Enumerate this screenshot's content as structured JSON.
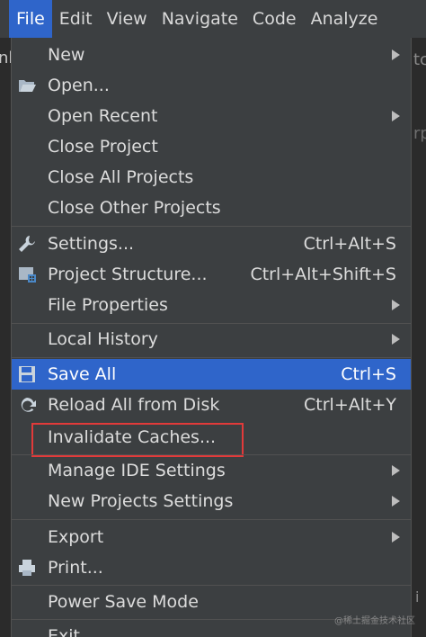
{
  "menubar": {
    "items": [
      "File",
      "Edit",
      "View",
      "Navigate",
      "Code",
      "Analyze"
    ],
    "active": "File"
  },
  "background": {
    "left_fragment": "nl",
    "right_fragment_top": "tc",
    "right_fragment_mid": "rp",
    "right_fragment_bottom": "i"
  },
  "menu": {
    "new": {
      "label": "New"
    },
    "open": {
      "label": "Open...",
      "icon": "folder-open-icon"
    },
    "open_recent": {
      "label": "Open Recent"
    },
    "close_project": {
      "label": "Close Project"
    },
    "close_all_projects": {
      "label": "Close All Projects"
    },
    "close_other_projects": {
      "label": "Close Other Projects"
    },
    "settings": {
      "label": "Settings...",
      "shortcut": "Ctrl+Alt+S",
      "icon": "wrench-icon"
    },
    "project_structure": {
      "label": "Project Structure...",
      "shortcut": "Ctrl+Alt+Shift+S",
      "icon": "project-structure-icon"
    },
    "file_properties": {
      "label": "File Properties"
    },
    "local_history": {
      "label": "Local History"
    },
    "save_all": {
      "label": "Save All",
      "shortcut": "Ctrl+S",
      "icon": "save-icon"
    },
    "reload_all": {
      "label": "Reload All from Disk",
      "shortcut": "Ctrl+Alt+Y",
      "icon": "reload-icon"
    },
    "invalidate_caches": {
      "label": "Invalidate Caches..."
    },
    "manage_ide_settings": {
      "label": "Manage IDE Settings"
    },
    "new_projects_settings": {
      "label": "New Projects Settings"
    },
    "export": {
      "label": "Export"
    },
    "print": {
      "label": "Print...",
      "icon": "printer-icon"
    },
    "power_save_mode": {
      "label": "Power Save Mode"
    },
    "exit": {
      "label": "Exit"
    }
  },
  "watermark": "@稀土掘金技术社区",
  "colors": {
    "menu_bg": "#3c3f41",
    "selection": "#2f65ca",
    "highlight_border": "#e23a3a",
    "text": "#dcdcdc"
  }
}
